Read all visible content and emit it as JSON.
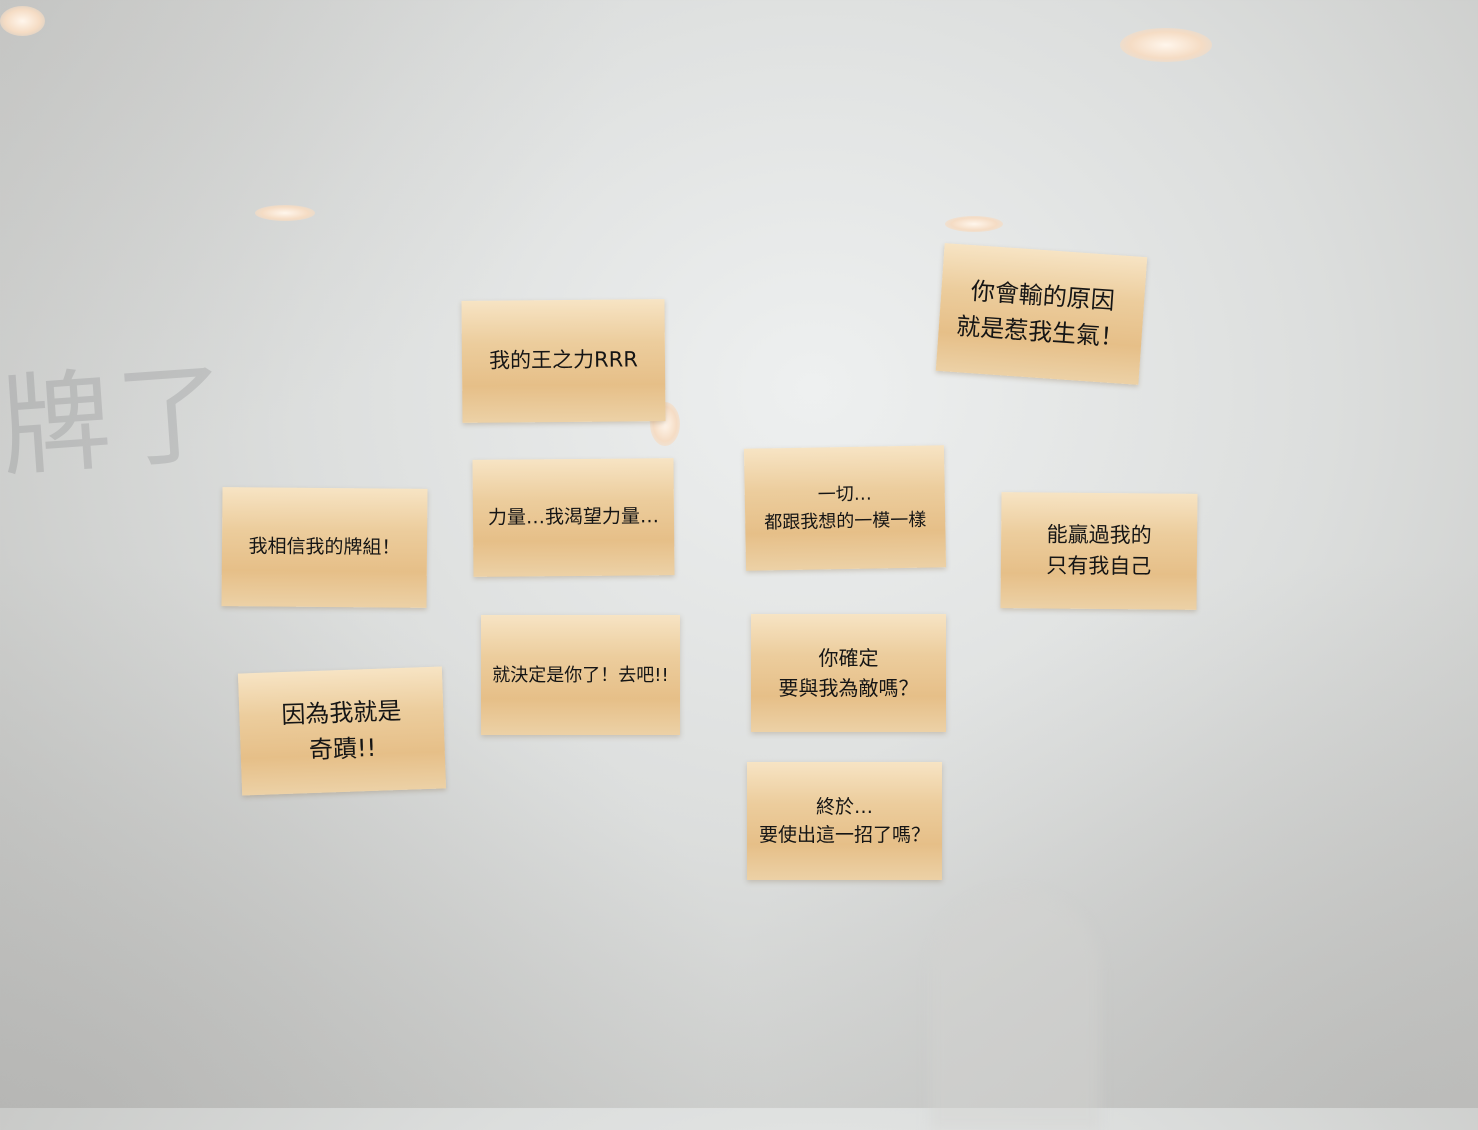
{
  "notes": [
    {
      "id": "wang-zhi-li",
      "lines": [
        "我的王之力RRR"
      ]
    },
    {
      "id": "ni-hui-shu",
      "lines": [
        "你會輸的原因",
        "就是惹我生氣！"
      ]
    },
    {
      "id": "li-liang",
      "lines": [
        "力量…我渴望力量…"
      ]
    },
    {
      "id": "yi-qie",
      "lines": [
        "一切…",
        "都跟我想的一模一樣"
      ]
    },
    {
      "id": "xiang-xin",
      "lines": [
        "我相信我的牌組！"
      ]
    },
    {
      "id": "neng-ying",
      "lines": [
        "能贏過我的",
        "只有我自己"
      ]
    },
    {
      "id": "jue-ding",
      "lines": [
        "就決定是你了！去吧!!"
      ]
    },
    {
      "id": "que-ding",
      "lines": [
        "你確定",
        "要與我為敵嗎？"
      ]
    },
    {
      "id": "qi-ji",
      "lines": [
        "因為我就是",
        "奇蹟!!"
      ]
    },
    {
      "id": "zhong-yu",
      "lines": [
        "終於…",
        "要使出這一招了嗎？"
      ]
    }
  ],
  "colors": {
    "note": "#ecc995",
    "ink": "#151515",
    "glass": "#d9dbda"
  }
}
